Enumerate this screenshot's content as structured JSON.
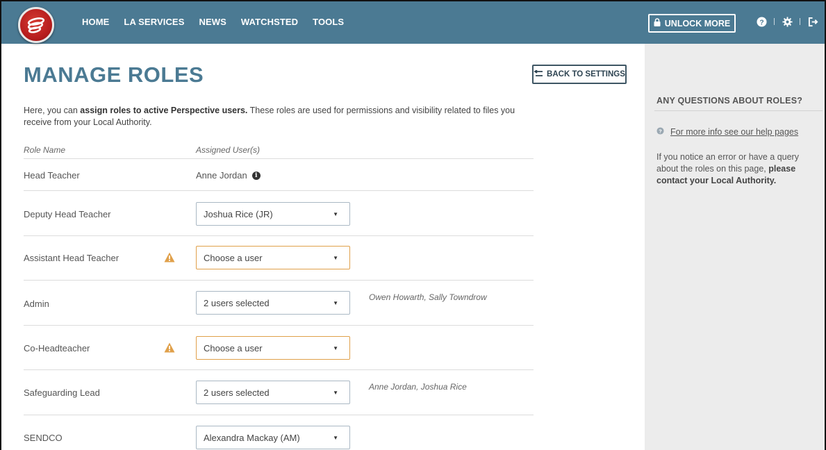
{
  "nav": {
    "items": [
      "HOME",
      "LA SERVICES",
      "NEWS",
      "WATCHSTED",
      "TOOLS"
    ],
    "unlock_label": "UNLOCK MORE",
    "icons": [
      "help-icon",
      "settings-icon",
      "logout-icon"
    ]
  },
  "page": {
    "title": "MANAGE ROLES",
    "back_label": "BACK TO SETTINGS",
    "intro_pre": "Here, you can ",
    "intro_bold": "assign roles to active Perspective users.",
    "intro_post": " These roles are used for permissions and visibility related to files you receive from your Local Authority."
  },
  "table": {
    "col_role": "Role Name",
    "col_users": "Assigned User(s)",
    "rows": [
      {
        "role": "Head Teacher",
        "assigned_text": "Anne Jordan",
        "type": "static"
      },
      {
        "role": "Deputy Head Teacher",
        "select_value": "Joshua Rice (JR)",
        "warning": false,
        "names": ""
      },
      {
        "role": "Assistant Head Teacher",
        "select_value": "Choose a user",
        "warning": true,
        "names": ""
      },
      {
        "role": "Admin",
        "select_value": "2 users selected",
        "warning": false,
        "names": "Owen Howarth, Sally Towndrow"
      },
      {
        "role": "Co-Headteacher",
        "select_value": "Choose a user",
        "warning": true,
        "names": ""
      },
      {
        "role": "Safeguarding Lead",
        "select_value": "2 users selected",
        "warning": false,
        "names": "Anne Jordan, Joshua Rice"
      },
      {
        "role": "SENDCO",
        "select_value": "Alexandra Mackay (AM)",
        "warning": false,
        "names": ""
      }
    ]
  },
  "sidebar": {
    "title": "ANY QUESTIONS ABOUT ROLES?",
    "help_link": "For more info see our help pages",
    "note_pre": "If you notice an error or have a query about the roles on this page, ",
    "note_bold": "please contact your Local Authority."
  },
  "colors": {
    "nav_bg": "#4b7a93",
    "title": "#4b7a93",
    "warning": "#e0a04a",
    "sidebar_bg": "#ececec"
  }
}
